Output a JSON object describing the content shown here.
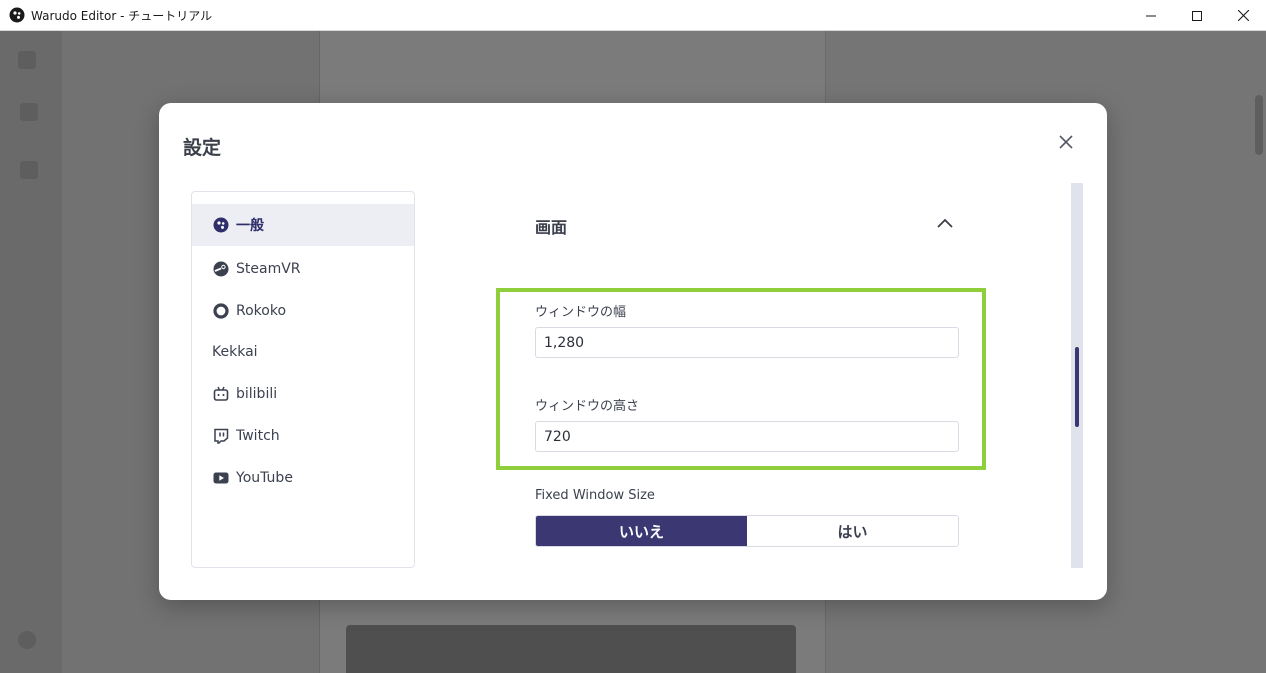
{
  "window": {
    "title": "Warudo Editor - チュートリアル",
    "controls": [
      "minimize-icon",
      "maximize-icon",
      "close-icon"
    ]
  },
  "modal": {
    "title": "設定",
    "nav": [
      {
        "label": "一般",
        "icon": "warudo-logo-icon",
        "active": true
      },
      {
        "label": "SteamVR",
        "icon": "steam-icon",
        "active": false
      },
      {
        "label": "Rokoko",
        "icon": "rokoko-icon",
        "active": false
      },
      {
        "label": "Kekkai",
        "icon": "",
        "active": false
      },
      {
        "label": "bilibili",
        "icon": "bilibili-icon",
        "active": false
      },
      {
        "label": "Twitch",
        "icon": "twitch-icon",
        "active": false
      },
      {
        "label": "YouTube",
        "icon": "youtube-icon",
        "active": false
      }
    ],
    "section": {
      "title": "画面",
      "expanded": true,
      "window_width_label": "ウィンドウの幅",
      "window_width_value": "1,280",
      "window_height_label": "ウィンドウの高さ",
      "window_height_value": "720",
      "fixed_size_label": "Fixed Window Size",
      "toggle_no": "いいえ",
      "toggle_yes": "はい",
      "toggle_selected": "いいえ"
    }
  },
  "colors": {
    "accent": "#3a3773",
    "highlight": "#8fcf3c"
  }
}
